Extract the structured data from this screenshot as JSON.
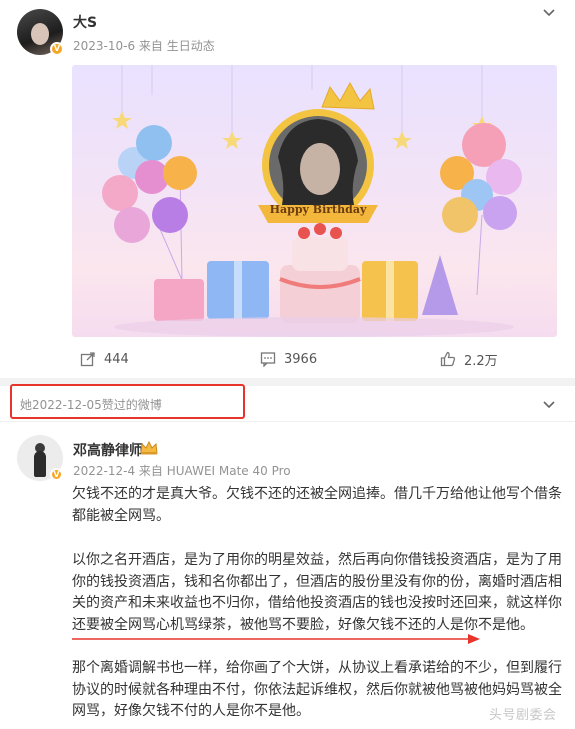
{
  "post1": {
    "username": "大S",
    "meta": "2023-10-6 来自 生日动态",
    "banner": {
      "badge_text": "Happy Birthday"
    },
    "actions": {
      "share_count": "444",
      "comment_count": "3966",
      "like_count": "2.2万"
    }
  },
  "liked_notice": "她2022-12-05赞过的微博",
  "post2": {
    "username": "邓高静律师",
    "meta": "2022-12-4 来自 HUAWEI Mate 40 Pro",
    "paragraphs": [
      "欠钱不还的才是真大爷。欠钱不还的还被全网追捧。借几千万给他让他写个借条都能被全网骂。",
      "以你之名开酒店，是为了用你的明星效益，然后再向你借钱投资酒店，是为了用你的钱投资酒店，钱和名你都出了，但酒店的股份里没有你的份，离婚时酒店相关的资产和未来收益也不归你，借给他投资酒店的钱也没按时还回来，就这样你还要被全网骂心机骂绿茶，被他骂不要脸，好像欠钱不还的人是你不是他。",
      "那个离婚调解书也一样，给你画了个大饼，从协议上看承诺给的不少，但到履行协议的时候就各种理由不付，你依法起诉维权，然后你就被他骂被他妈妈骂被全网骂，好像欠钱不付的人是你不是他。"
    ]
  },
  "watermark": "头号剧委会",
  "colors": {
    "highlight_red": "#e8352b",
    "meta_gray": "#939393",
    "badge_orange": "#f5a623"
  },
  "icons": [
    "chevron-down-icon",
    "share-icon",
    "comment-icon",
    "like-icon",
    "verified-badge-icon",
    "crown-badge-icon"
  ]
}
